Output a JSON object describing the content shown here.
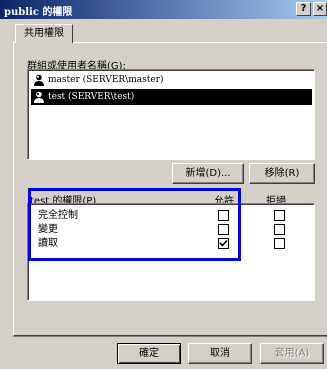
{
  "window": {
    "title": "public 的權限",
    "help": "?",
    "close": "×"
  },
  "tabs": [
    "共用權限"
  ],
  "users_section": {
    "label": "群組或使用者名稱(G):",
    "users": [
      {
        "name": "master (SERVER\\master)",
        "selected": false
      },
      {
        "name": "test (SERVER\\test)",
        "selected": true
      }
    ],
    "add_button": "新增(D)...",
    "remove_button": "移除(R)"
  },
  "permissions": {
    "header": "test 的權限(P)",
    "allow_col": "允許",
    "deny_col": "拒絕",
    "rows": [
      {
        "name": "完全控制",
        "allow": false,
        "deny": false
      },
      {
        "name": "變更",
        "allow": false,
        "deny": false
      },
      {
        "name": "讀取",
        "allow": true,
        "deny": false
      }
    ]
  },
  "footer": {
    "ok": "確定",
    "cancel": "取消",
    "apply": "套用(A)"
  },
  "colors": {
    "title_start": "#0a246a",
    "title_end": "#a6caf0",
    "face": "#d4d0c8",
    "highlight_box": "#0000ee"
  }
}
